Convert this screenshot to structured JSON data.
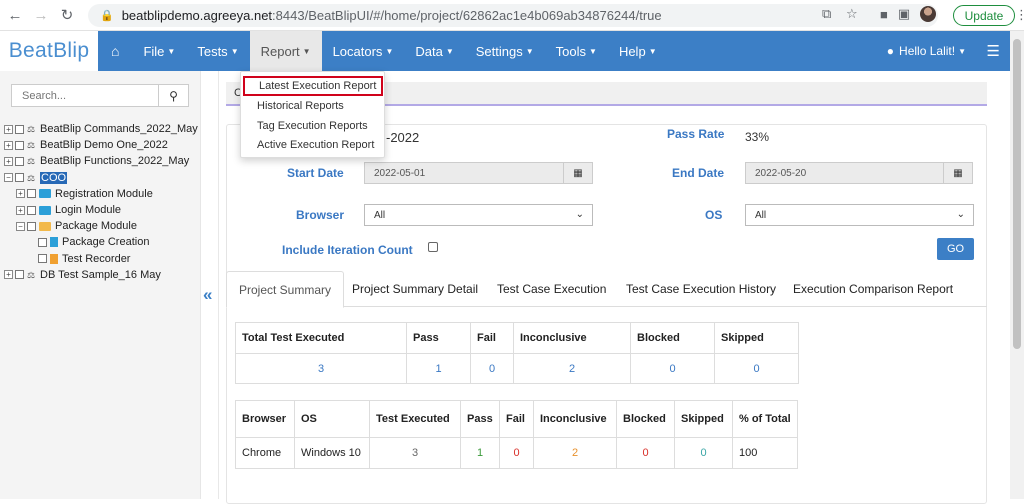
{
  "browser": {
    "url_host": "beatblipdemo.agreeya.net",
    "url_path": ":8443/BeatBlipUI/#/home/project/62862ac1e4b069ab34876244/true",
    "update_label": "Update"
  },
  "navbar": {
    "brand": "BeatBlip",
    "menu": [
      "File",
      "Tests",
      "Report",
      "Locators",
      "Data",
      "Settings",
      "Tools",
      "Help"
    ],
    "user": "Hello Lalit!"
  },
  "report_menu": {
    "items": [
      "Latest Execution Report",
      "Historical Reports",
      "Tag Execution Reports",
      "Active Execution Report"
    ]
  },
  "sidebar": {
    "search_placeholder": "Search...",
    "tree": [
      {
        "label": "BeatBlip Commands_2022_May"
      },
      {
        "label": "BeatBlip Demo One_2022"
      },
      {
        "label": "BeatBlip Functions_2022_May"
      },
      {
        "label": "COO"
      },
      {
        "label": "Registration Module"
      },
      {
        "label": "Login Module"
      },
      {
        "label": "Package Module"
      },
      {
        "label": "Package Creation"
      },
      {
        "label": "Test Recorder"
      },
      {
        "label": "DB Test Sample_16 May"
      }
    ]
  },
  "main": {
    "crumb_partial": "C",
    "date_partial": "-2022",
    "pass_rate_label": "Pass Rate",
    "pass_rate": "33%",
    "start_date_label": "Start Date",
    "start_date": "2022-05-01",
    "end_date_label": "End Date",
    "end_date": "2022-05-20",
    "browser_label": "Browser",
    "browser_value": "All",
    "os_label": "OS",
    "os_value": "All",
    "include_iteration_label": "Include Iteration Count",
    "go_label": "GO",
    "tabs": [
      "Project Summary",
      "Project Summary Detail",
      "Test Case Execution",
      "Test Case Execution History",
      "Execution Comparison Report"
    ]
  },
  "summary_table": {
    "headers": [
      "Total Test Executed",
      "Pass",
      "Fail",
      "Inconclusive",
      "Blocked",
      "Skipped"
    ],
    "values": [
      "3",
      "1",
      "0",
      "2",
      "0",
      "0"
    ]
  },
  "browser_table": {
    "headers": [
      "Browser",
      "OS",
      "Test Executed",
      "Pass",
      "Fail",
      "Inconclusive",
      "Blocked",
      "Skipped",
      "% of Total"
    ],
    "row": [
      "Chrome",
      "Windows 10",
      "3",
      "1",
      "0",
      "2",
      "0",
      "0",
      "100"
    ]
  },
  "colors": {
    "navbar": "#3c7fc6",
    "label_blue": "#3a78c3",
    "pass": "#3a9a3a",
    "fail": "#d9302a",
    "inconclusive": "#e8912c",
    "skipped": "#3aa6a6",
    "highlight_box": "#d0021b"
  }
}
